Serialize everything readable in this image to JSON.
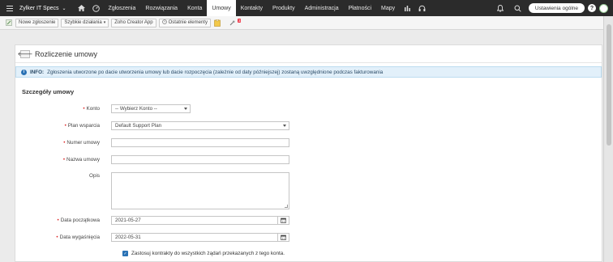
{
  "topnav": {
    "brand": "Zylker IT Specs",
    "items": [
      "Zgłoszenia",
      "Rozwiązania",
      "Konta",
      "Umowy",
      "Kontakty",
      "Produkty",
      "Administracja",
      "Płatności",
      "Mapy"
    ],
    "active": "Umowy",
    "settings_label": "Ustawienia ogólne",
    "help_label": "?"
  },
  "toolbar": {
    "new_request": "Nowe zgłoszenie",
    "quick_actions": "Szybkie działania",
    "zoho_app": "Zoho Creator App",
    "recent": "Ostatnie elementy",
    "badge_count": "3"
  },
  "page": {
    "title": "Rozliczenie umowy",
    "info_prefix": "INFO:",
    "info_text": "Zgłoszenia utworzone po dacie utworzenia umowy lub dacie rozpoczęcia (zależnie od daty późniejszej) zostaną uwzględnione podczas fakturowania",
    "section_title": "Szczegóły umowy"
  },
  "form": {
    "account_label": "Konto",
    "account_value": "-- Wybierz Konto --",
    "plan_label": "Plan wsparcia",
    "plan_value": "Default Support Plan",
    "number_label": "Numer umowy",
    "number_value": "",
    "name_label": "Nazwa umowy",
    "name_value": "",
    "description_label": "Opis",
    "start_label": "Data początkowa",
    "start_value": "2021-05-27",
    "end_label": "Data wygaśnięcia",
    "end_value": "2022-05-31",
    "apply_label": "Zastosuj kontrakty do wszystkich żądań przekazanych z tego konta.",
    "apply_checked": true
  },
  "colors": {
    "nav_bg": "#2b2b2b",
    "accent": "#2a72b5",
    "required": "#dd2222",
    "info_bg": "#e2f0fa"
  }
}
